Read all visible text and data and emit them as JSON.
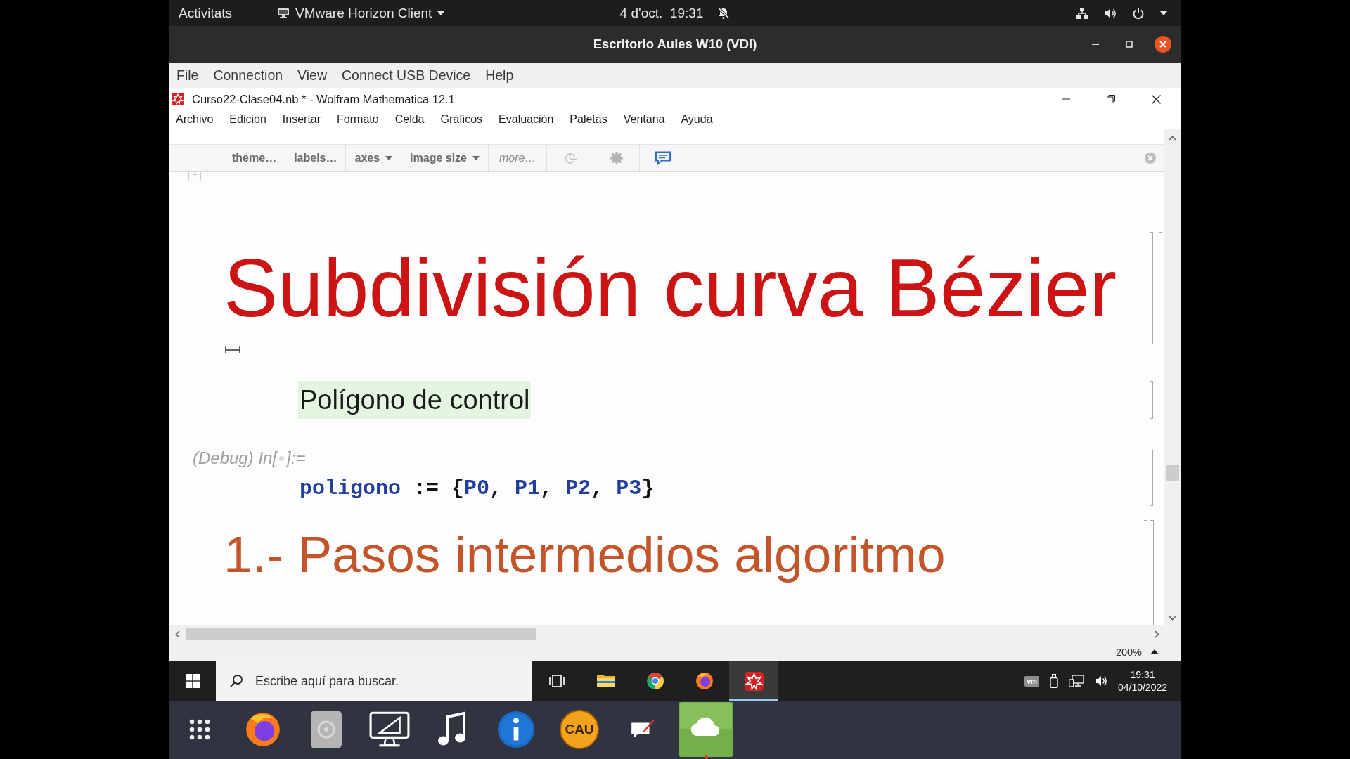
{
  "top_bar": {
    "activities": "Activitats",
    "app_menu": "VMware Horizon Client",
    "clock": "4 d'oct.  19:31"
  },
  "window": {
    "title": "Escritorio Aules W10 (VDI)"
  },
  "vmware_menu": [
    "File",
    "Connection",
    "View",
    "Connect USB Device",
    "Help"
  ],
  "mathematica": {
    "title": "Curso22-Clase04.nb * - Wolfram Mathematica 12.1",
    "menu": [
      "Archivo",
      "Edición",
      "Insertar",
      "Formato",
      "Celda",
      "Gráficos",
      "Evaluación",
      "Paletas",
      "Ventana",
      "Ayuda"
    ],
    "suggestions_bar": [
      {
        "kind": "text",
        "label": "theme…"
      },
      {
        "kind": "text",
        "label": "labels…"
      },
      {
        "kind": "dropdown",
        "label": "axes"
      },
      {
        "kind": "dropdown",
        "label": "image size"
      },
      {
        "kind": "more",
        "label": "more…"
      }
    ],
    "cells": [
      {
        "kind": "title",
        "text": "Subdivisión curva Bézier"
      },
      {
        "kind": "text",
        "text": "Polígono de control"
      },
      {
        "kind": "input",
        "prompt_prefix": "(Debug) In[",
        "prompt_suffix": "]:=",
        "tokens": [
          {
            "kind": "symbol",
            "text": "poligono"
          },
          {
            "kind": "plain",
            "text": " := {"
          },
          {
            "kind": "symbol",
            "text": "P0"
          },
          {
            "kind": "plain",
            "text": ", "
          },
          {
            "kind": "symbol",
            "text": "P1"
          },
          {
            "kind": "plain",
            "text": ", "
          },
          {
            "kind": "symbol",
            "text": "P2"
          },
          {
            "kind": "plain",
            "text": ", "
          },
          {
            "kind": "symbol",
            "text": "P3"
          },
          {
            "kind": "plain",
            "text": "}"
          }
        ]
      },
      {
        "kind": "section",
        "text": "1.- Pasos intermedios algoritmo"
      }
    ],
    "zoom": "200%"
  },
  "taskbar": {
    "search": {
      "placeholder": "Escribe aquí para buscar."
    },
    "apps": [
      {
        "kind": "task-view",
        "selected": false
      },
      {
        "kind": "folder",
        "selected": false
      },
      {
        "kind": "chrome",
        "selected": false
      },
      {
        "kind": "firefox",
        "selected": false
      },
      {
        "kind": "mathematica",
        "selected": true
      }
    ],
    "tray_badge": "vm",
    "time": "19:31",
    "date": "04/10/2022"
  },
  "dock": [
    {
      "kind": "grid",
      "running": false
    },
    {
      "kind": "firefox",
      "running": false
    },
    {
      "kind": "disc",
      "running": false
    },
    {
      "kind": "monitor",
      "running": false
    },
    {
      "kind": "music",
      "running": false
    },
    {
      "kind": "info",
      "running": false
    },
    {
      "kind": "badge",
      "label": "CAU",
      "running": false
    },
    {
      "kind": "note",
      "running": false
    },
    {
      "kind": "cloud",
      "running": true
    }
  ]
}
